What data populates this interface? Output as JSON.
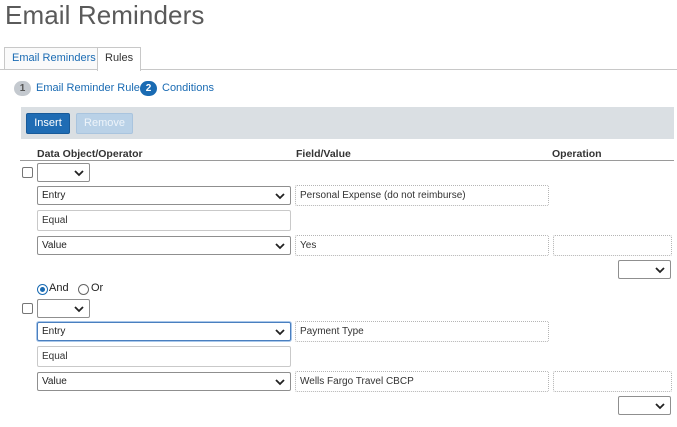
{
  "page": {
    "title": "Email Reminders"
  },
  "tabs": [
    {
      "label": "Email Reminders"
    },
    {
      "label": "Rules"
    }
  ],
  "steps": [
    {
      "num": "1",
      "label": "Email Reminder Rule"
    },
    {
      "num": "2",
      "label": "Conditions"
    }
  ],
  "toolbar": {
    "insert_label": "Insert",
    "remove_label": "Remove"
  },
  "columns": {
    "data_object": "Data Object/Operator",
    "field_value": "Field/Value",
    "operation": "Operation"
  },
  "condition1": {
    "group_select": "",
    "entry_select": "Entry",
    "entry_field": "Personal Expense  (do not reimburse)",
    "operator": "Equal",
    "value_select": "Value",
    "value_field": "Yes",
    "operation_input": "",
    "operation_select": ""
  },
  "connector": {
    "and_label": "And",
    "or_label": "Or",
    "selected": "And"
  },
  "condition2": {
    "group_select": "",
    "entry_select": "Entry",
    "entry_field": "Payment Type",
    "operator": "Equal",
    "value_select": "Value",
    "value_field": "Wells Fargo Travel CBCP",
    "operation_input": "",
    "operation_select": ""
  }
}
